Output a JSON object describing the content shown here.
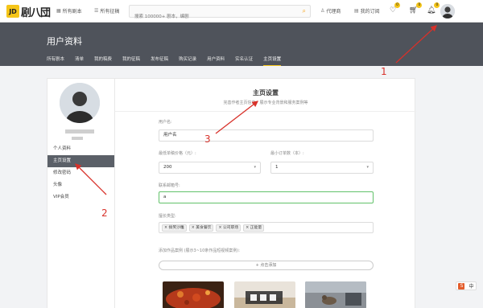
{
  "topbar": {
    "logo_badge": "JD",
    "logo_text": "剧八団",
    "nav_all_scripts": "所有剧本",
    "nav_all_reviews": "所有征稿",
    "search_placeholder": "搜索 100000+ 剧本，编剧",
    "nav_agent": "代理商",
    "nav_my_orders": "我的订阅",
    "heart_count": "0",
    "cart_count": "0",
    "bell_count": "0"
  },
  "header": {
    "title": "用户资料",
    "tabs": [
      {
        "label": "所有剧本"
      },
      {
        "label": "清单"
      },
      {
        "label": "我的稿费"
      },
      {
        "label": "我的征稿"
      },
      {
        "label": "发布征稿"
      },
      {
        "label": "购买记录"
      },
      {
        "label": "用户资料"
      },
      {
        "label": "实名认证"
      },
      {
        "label": "主页设置"
      }
    ]
  },
  "sidebar": {
    "items": [
      {
        "label": "个人资料"
      },
      {
        "label": "主页设置"
      },
      {
        "label": "修改密码"
      },
      {
        "label": "头像"
      },
      {
        "label": "VIP会员"
      }
    ]
  },
  "main": {
    "title": "主页设置",
    "subtitle": "完善作者主页信息，展示专业背景和服务案例等",
    "username_label": "用户名:",
    "username_value": "用户名",
    "price_label": "最低单稿价格（元）:",
    "price_value": "200",
    "min_order_label": "最小订单数（本）:",
    "min_order_value": "1",
    "contact_label": "联系邮箱号:",
    "contact_value": "a",
    "genre_label": "擅长类型:",
    "genre_tags": [
      "× 搞笑沙雕",
      "× 美食餐饮",
      "× 公司职场",
      "× 正能量"
    ],
    "works_label": "添加作品案例 (展示3~10条作品短视频案例):",
    "add_button": "+ 点击添加"
  },
  "annotations": {
    "n1": "1",
    "n2": "2",
    "n3": "3"
  },
  "ime_widget": {
    "logo": "S",
    "lang": "中"
  },
  "colors": {
    "accent": "#f5c518",
    "header_bg": "#4f535b",
    "annotation": "#d8312a",
    "focus": "#62c26a"
  }
}
